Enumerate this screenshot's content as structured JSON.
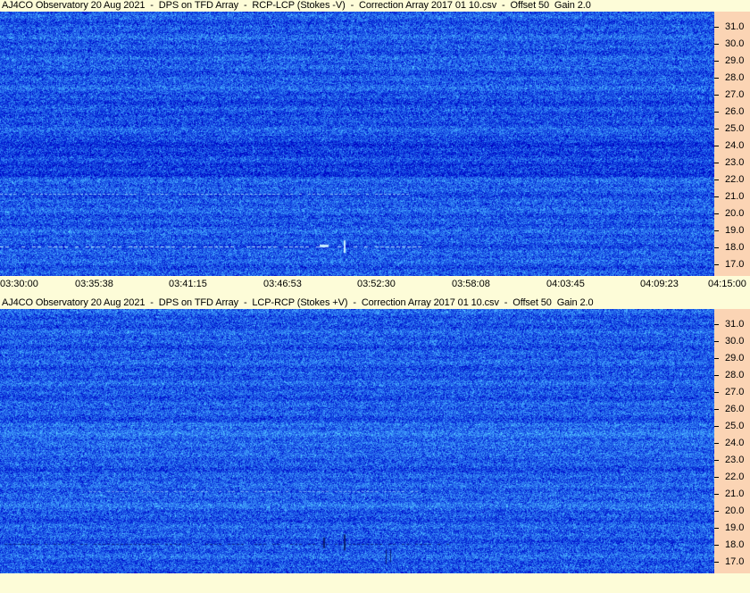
{
  "panels": [
    {
      "title": "AJ4CO Observatory 20 Aug 2021  -  DPS on TFD Array  -  RCP-LCP (Stokes -V)  -  Correction Array 2017 01 10.csv  -  Offset 50  Gain 2.0"
    },
    {
      "title": "AJ4CO Observatory 20 Aug 2021  -  DPS on TFD Array  -  LCP-RCP (Stokes +V)  -  Correction Array 2017 01 10.csv  -  Offset 50  Gain 2.0"
    }
  ],
  "chart_data": [
    {
      "type": "heatmap",
      "title": "AJ4CO Observatory 20 Aug 2021  -  DPS on TFD Array  -  RCP-LCP (Stokes -V)  -  Correction Array 2017 01 10.csv  -  Offset 50  Gain 2.0",
      "y_tick_labels": [
        "31.0",
        "30.0",
        "29.0",
        "28.0",
        "27.0",
        "26.0",
        "25.0",
        "24.0",
        "23.0",
        "22.0",
        "21.0",
        "20.0",
        "19.0",
        "18.0",
        "17.0"
      ],
      "ylim": [
        16.3,
        31.9
      ],
      "x_tick_labels": [
        "03:30:00",
        "03:35:38",
        "03:41:15",
        "03:46:53",
        "03:52:30",
        "03:58:08",
        "04:03:45",
        "04:09:23",
        "04:15:00"
      ],
      "xlim": [
        "03:30:00",
        "04:15:00"
      ],
      "colors": {
        "background": "#1e5ae0",
        "light": "#5a9cff",
        "dark": "#0b2a9c"
      }
    },
    {
      "type": "heatmap",
      "title": "AJ4CO Observatory 20 Aug 2021  -  DPS on TFD Array  -  LCP-RCP (Stokes +V)  -  Correction Array 2017 01 10.csv  -  Offset 50  Gain 2.0",
      "y_tick_labels": [
        "31.0",
        "30.0",
        "29.0",
        "28.0",
        "27.0",
        "26.0",
        "25.0",
        "24.0",
        "23.0",
        "22.0",
        "21.0",
        "20.0",
        "19.0",
        "18.0",
        "17.0"
      ],
      "ylim": [
        16.3,
        31.9
      ],
      "x_tick_labels": [],
      "xlim": [
        "03:30:00",
        "04:15:00"
      ],
      "colors": {
        "background": "#2a6ae8",
        "light": "#5a9cff",
        "dark": "#0b2a9c"
      }
    }
  ]
}
